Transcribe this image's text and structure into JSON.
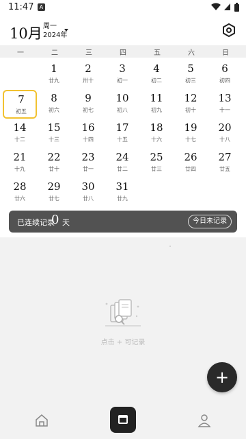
{
  "status": {
    "time": "11:47",
    "notification": "A"
  },
  "header": {
    "month": "10月",
    "weekday": "周一",
    "year": "2024年"
  },
  "weekdays": [
    "一",
    "二",
    "三",
    "四",
    "五",
    "六",
    "日"
  ],
  "days": [
    {
      "num": "1",
      "lunar": "廿九"
    },
    {
      "num": "2",
      "lunar": "卅十"
    },
    {
      "num": "3",
      "lunar": "初一"
    },
    {
      "num": "4",
      "lunar": "初二"
    },
    {
      "num": "5",
      "lunar": "初三"
    },
    {
      "num": "6",
      "lunar": "初四"
    },
    {
      "num": "7",
      "lunar": "初五"
    },
    {
      "num": "8",
      "lunar": "初六"
    },
    {
      "num": "9",
      "lunar": "初七"
    },
    {
      "num": "10",
      "lunar": "初八"
    },
    {
      "num": "11",
      "lunar": "初九"
    },
    {
      "num": "12",
      "lunar": "初十"
    },
    {
      "num": "13",
      "lunar": "十一"
    },
    {
      "num": "14",
      "lunar": "十二"
    },
    {
      "num": "15",
      "lunar": "十三"
    },
    {
      "num": "16",
      "lunar": "十四"
    },
    {
      "num": "17",
      "lunar": "十五"
    },
    {
      "num": "18",
      "lunar": "十六"
    },
    {
      "num": "19",
      "lunar": "十七"
    },
    {
      "num": "20",
      "lunar": "十八"
    },
    {
      "num": "21",
      "lunar": "十九"
    },
    {
      "num": "22",
      "lunar": "廿十"
    },
    {
      "num": "23",
      "lunar": "廿一"
    },
    {
      "num": "24",
      "lunar": "廿二"
    },
    {
      "num": "25",
      "lunar": "廿三"
    },
    {
      "num": "26",
      "lunar": "廿四"
    },
    {
      "num": "27",
      "lunar": "廿五"
    },
    {
      "num": "28",
      "lunar": "廿六"
    },
    {
      "num": "29",
      "lunar": "廿七"
    },
    {
      "num": "30",
      "lunar": "廿八"
    },
    {
      "num": "31",
      "lunar": "廿九"
    }
  ],
  "streak": {
    "label": "已连续记录",
    "count": "0",
    "unit": "天",
    "today_button": "今日未记录"
  },
  "empty": {
    "text": "点击 + 可记录"
  },
  "fab": {
    "label": "+"
  },
  "colors": {
    "selected_border": "#f2c230",
    "streak_bg": "#525252",
    "dark": "#222222"
  },
  "icons": [
    "settings-icon",
    "home-icon",
    "calendar-icon",
    "profile-icon",
    "document-search-icon",
    "plus-icon"
  ]
}
